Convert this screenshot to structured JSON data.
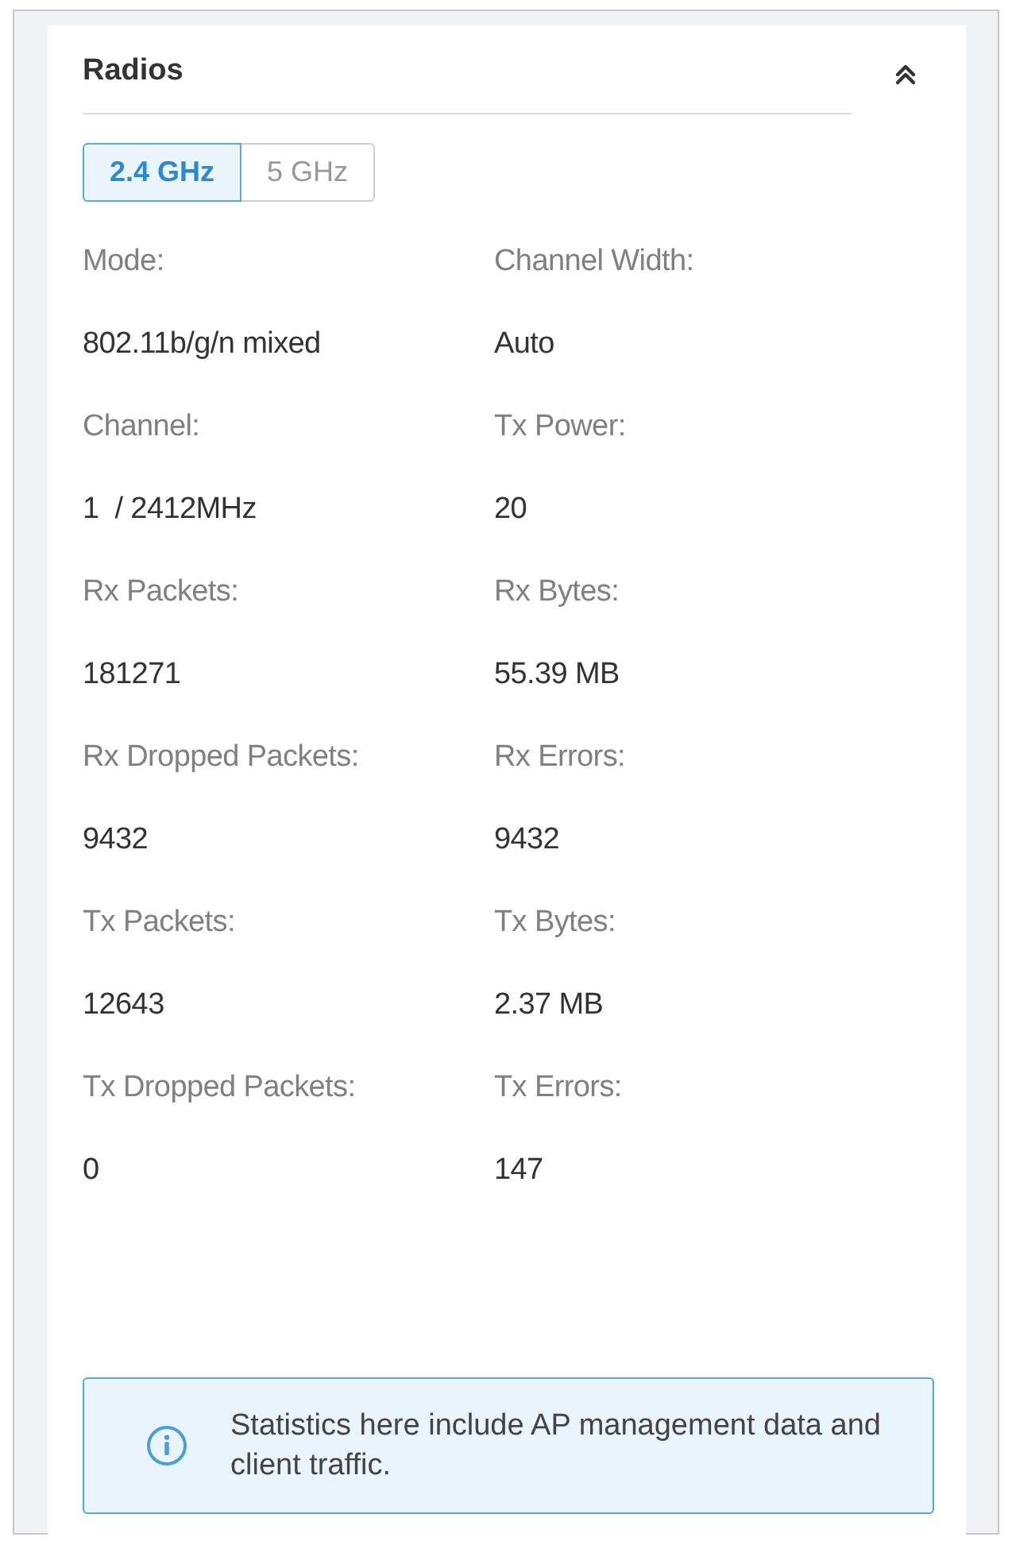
{
  "panel": {
    "title": "Radios",
    "expanded": true
  },
  "tabs": [
    {
      "label": "2.4 GHz",
      "selected": true
    },
    {
      "label": "5 GHz",
      "selected": false
    }
  ],
  "fields": [
    {
      "label": "Mode:",
      "value": "802.11b/g/n mixed"
    },
    {
      "label": "Channel Width:",
      "value": "Auto"
    },
    {
      "label": "Channel:",
      "value": "1  / 2412MHz"
    },
    {
      "label": "Tx Power:",
      "value": "20"
    },
    {
      "label": "Rx Packets:",
      "value": "181271"
    },
    {
      "label": "Rx Bytes:",
      "value": "55.39 MB"
    },
    {
      "label": "Rx Dropped Packets:",
      "value": "9432"
    },
    {
      "label": "Rx Errors:",
      "value": "9432"
    },
    {
      "label": "Tx Packets:",
      "value": "12643"
    },
    {
      "label": "Tx Bytes:",
      "value": "2.37 MB"
    },
    {
      "label": "Tx Dropped Packets:",
      "value": "0"
    },
    {
      "label": "Tx Errors:",
      "value": "147"
    }
  ],
  "info": {
    "text": "Statistics here include AP management data and client traffic."
  }
}
